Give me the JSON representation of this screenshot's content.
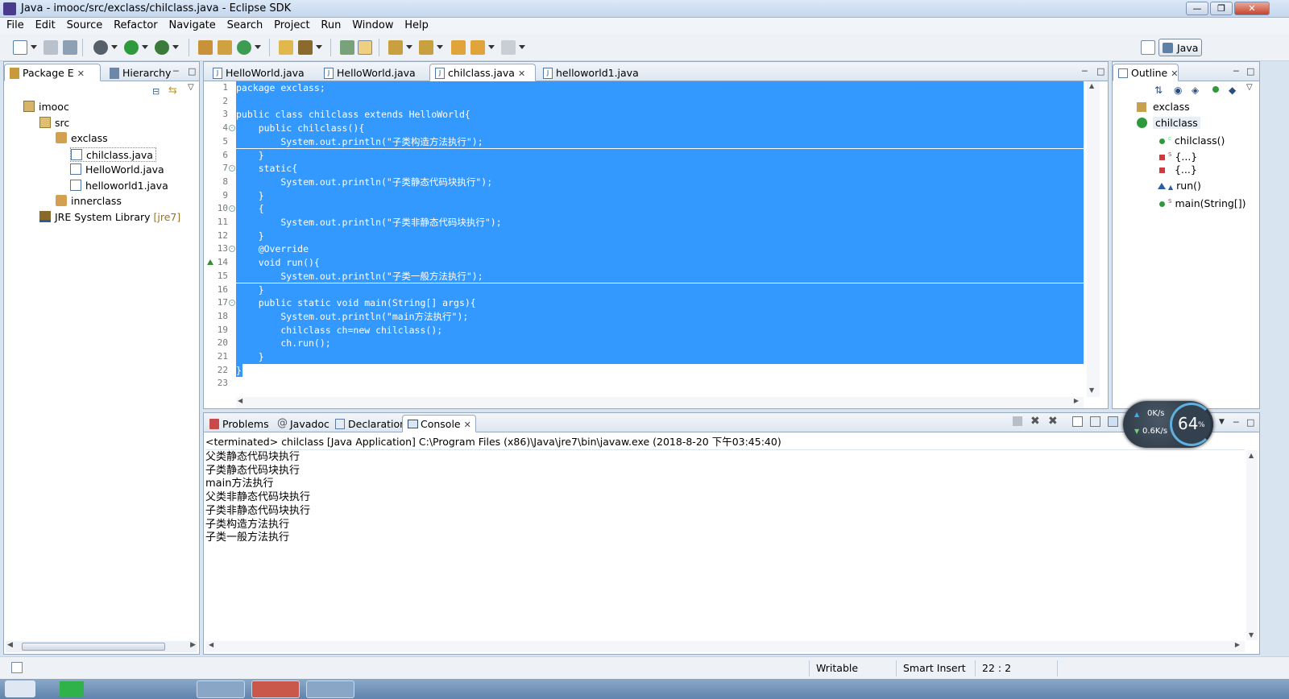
{
  "window": {
    "title": "Java - imooc/src/exclass/chilclass.java - Eclipse SDK"
  },
  "menu": [
    "File",
    "Edit",
    "Source",
    "Refactor",
    "Navigate",
    "Search",
    "Project",
    "Run",
    "Window",
    "Help"
  ],
  "perspective": {
    "label": "Java"
  },
  "package_explorer": {
    "tabs": [
      {
        "label": "Package E"
      },
      {
        "label": "Hierarchy"
      }
    ],
    "tree": [
      {
        "label": "imooc",
        "depth": 0,
        "icon": "project-icon"
      },
      {
        "label": "src",
        "depth": 1,
        "icon": "source-folder-icon"
      },
      {
        "label": "exclass",
        "depth": 2,
        "icon": "package-icon"
      },
      {
        "label": "chilclass.java",
        "depth": 3,
        "icon": "java-file-icon",
        "selected": true
      },
      {
        "label": "HelloWorld.java",
        "depth": 3,
        "icon": "java-file-icon"
      },
      {
        "label": "helloworld1.java",
        "depth": 3,
        "icon": "java-file-icon"
      },
      {
        "label": "innerclass",
        "depth": 2,
        "icon": "package-icon"
      },
      {
        "label": "JRE System Library",
        "suffix": "[jre7]",
        "depth": 1,
        "icon": "library-icon"
      }
    ]
  },
  "editor": {
    "tabs": [
      {
        "label": "HelloWorld.java",
        "active": false
      },
      {
        "label": "HelloWorld.java",
        "active": false
      },
      {
        "label": "chilclass.java",
        "active": true
      },
      {
        "label": "helloworld1.java",
        "active": false
      }
    ],
    "lines": [
      {
        "n": "1",
        "text": "package exclass;"
      },
      {
        "n": "2",
        "text": ""
      },
      {
        "n": "3",
        "text": "public class chilclass extends HelloWorld{"
      },
      {
        "n": "4",
        "text": "    public chilclass(){"
      },
      {
        "n": "5",
        "text": "        System.out.println(\"子类构造方法执行\");"
      },
      {
        "n": "6",
        "text": "    }"
      },
      {
        "n": "7",
        "text": "    static{"
      },
      {
        "n": "8",
        "text": "        System.out.println(\"子类静态代码块执行\");"
      },
      {
        "n": "9",
        "text": "    }"
      },
      {
        "n": "10",
        "text": "    {"
      },
      {
        "n": "11",
        "text": "        System.out.println(\"子类非静态代码块执行\");"
      },
      {
        "n": "12",
        "text": "    }"
      },
      {
        "n": "13",
        "text": "    @Override"
      },
      {
        "n": "14",
        "text": "    void run(){"
      },
      {
        "n": "15",
        "text": "        System.out.println(\"子类一般方法执行\");"
      },
      {
        "n": "16",
        "text": "    }"
      },
      {
        "n": "17",
        "text": "    public static void main(String[] args){"
      },
      {
        "n": "18",
        "text": "        System.out.println(\"main方法执行\");"
      },
      {
        "n": "19",
        "text": "        chilclass ch=new chilclass();"
      },
      {
        "n": "20",
        "text": "        ch.run();"
      },
      {
        "n": "21",
        "text": "    }"
      },
      {
        "n": "22",
        "text": "}"
      },
      {
        "n": "23",
        "text": ""
      }
    ]
  },
  "outline": {
    "tab": "Outline",
    "items": [
      {
        "label": "exclass",
        "depth": 0,
        "icon": "package-decl-icon"
      },
      {
        "label": "chilclass",
        "depth": 0,
        "icon": "class-icon",
        "selected": true
      },
      {
        "label": "chilclass()",
        "depth": 1,
        "icon": "constructor-icon",
        "mark": "c"
      },
      {
        "label": "{...}",
        "depth": 1,
        "icon": "static-init-icon",
        "mark": "S"
      },
      {
        "label": "{...}",
        "depth": 1,
        "icon": "init-icon",
        "mark": ""
      },
      {
        "label": "run()",
        "depth": 1,
        "icon": "method-override-icon",
        "mark": ""
      },
      {
        "label": "main(String[])",
        "depth": 1,
        "icon": "static-method-icon",
        "mark": "S"
      }
    ]
  },
  "bottom": {
    "tabs": [
      {
        "label": "Problems"
      },
      {
        "label": "Javadoc"
      },
      {
        "label": "Declaration"
      },
      {
        "label": "Console",
        "active": true
      }
    ],
    "console_header": "<terminated> chilclass [Java Application] C:\\Program Files (x86)\\Java\\jre7\\bin\\javaw.exe (2018-8-20 下午03:45:40)",
    "console_lines": [
      "父类静态代码块执行",
      "子类静态代码块执行",
      "main方法执行",
      "父类非静态代码块执行",
      "子类非静态代码块执行",
      "子类构造方法执行",
      "子类一般方法执行"
    ]
  },
  "net_widget": {
    "up": "0K/s",
    "down": "0.6K/s",
    "percent": "64",
    "percent_unit": "%"
  },
  "status": {
    "writable": "Writable",
    "insert_mode": "Smart Insert",
    "position": "22 : 2"
  },
  "colors": {
    "selection": "#3399ff",
    "accent": "#96a9c0"
  }
}
